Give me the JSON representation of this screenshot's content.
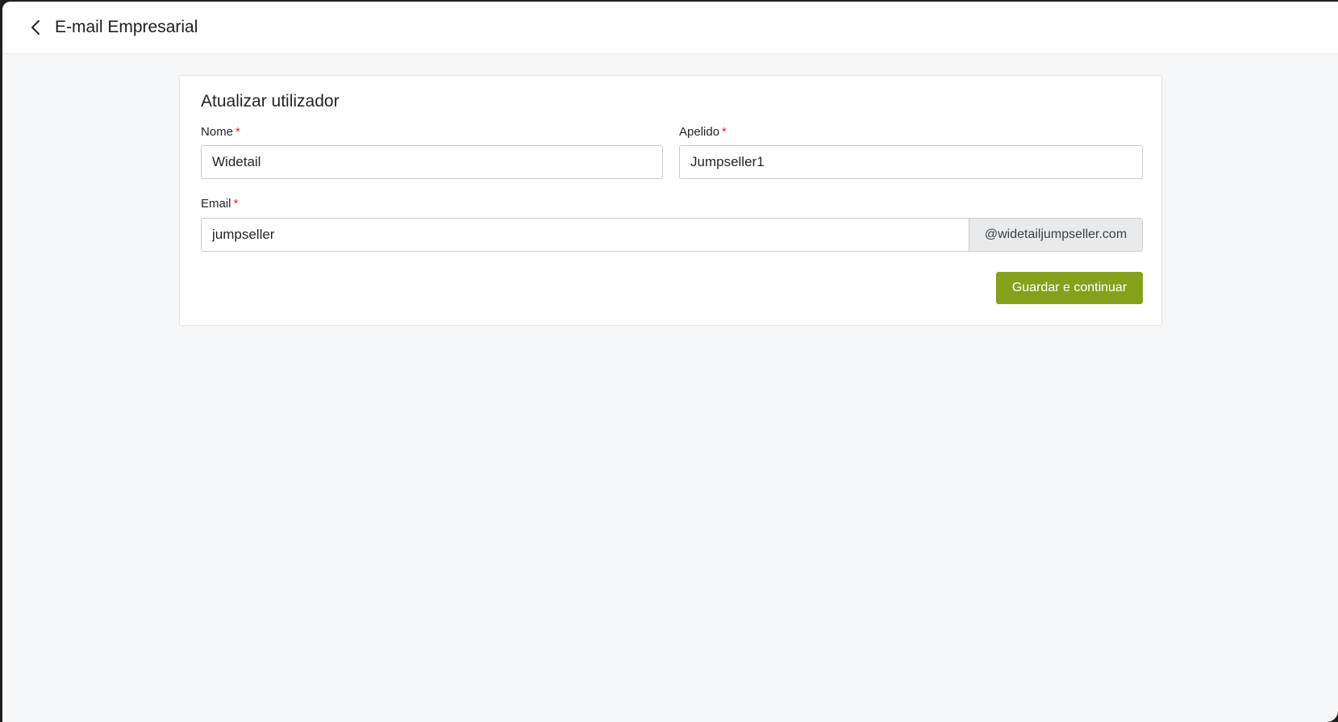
{
  "header": {
    "title": "E-mail Empresarial",
    "back_icon": "chevron-left-icon"
  },
  "form": {
    "title": "Atualizar utilizador",
    "required_marker": "*",
    "first_name": {
      "label": "Nome",
      "value": "Widetail"
    },
    "last_name": {
      "label": "Apelido",
      "value": "Jumpseller1"
    },
    "email": {
      "label": "Email",
      "value": "jumpseller",
      "domain_suffix": "@widetailjumpseller.com"
    },
    "submit_label": "Guardar e continuar"
  },
  "colors": {
    "accent": "#85a11c",
    "required": "#e0242b",
    "background": "#f6f7f9"
  }
}
